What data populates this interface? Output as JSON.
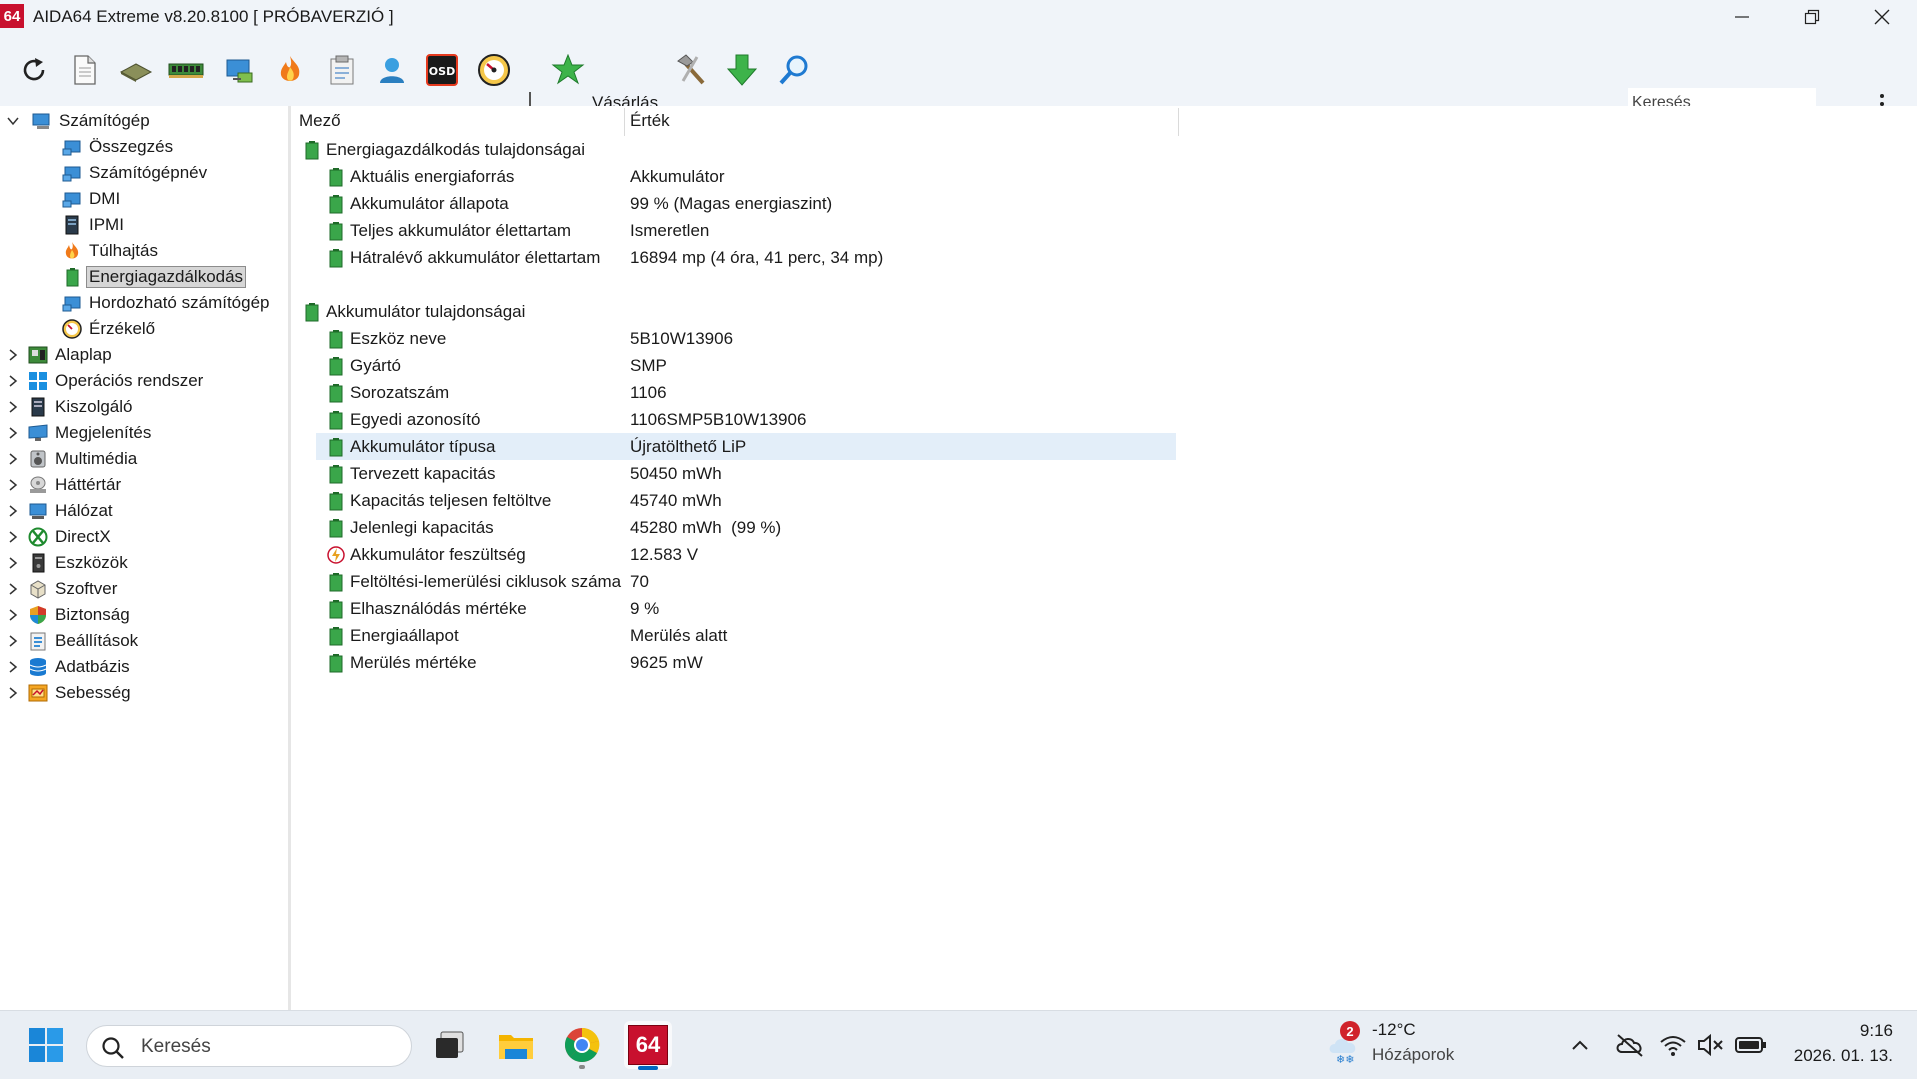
{
  "window": {
    "logo": "64",
    "title": "AIDA64 Extreme v8.20.8100  [ PRÓBAVERZIÓ ]"
  },
  "toolbar": {
    "buy_label": "Vásárlás",
    "search_placeholder": "Keresés",
    "buttons": [
      "refresh-icon",
      "report-icon",
      "motherboard-icon",
      "memory-icon",
      "computer-icon",
      "flame-icon",
      "clipboard-icon",
      "user-icon",
      "osd-icon",
      "speedometer-icon",
      "buy-star-icon",
      "tools-icon",
      "download-arrow-icon",
      "magnifier-icon"
    ],
    "osd_text": "OSD"
  },
  "tree": {
    "root": "Számítógép",
    "children": [
      "Összegzés",
      "Számítógépnév",
      "DMI",
      "IPMI",
      "Túlhajtás",
      "Energiagazdálkodás",
      "Hordozható számítógép",
      "Érzékelő"
    ],
    "selected": "Energiagazdálkodás",
    "categories": [
      "Alaplap",
      "Operációs rendszer",
      "Kiszolgáló",
      "Megjelenítés",
      "Multimédia",
      "Háttértár",
      "Hálózat",
      "DirectX",
      "Eszközök",
      "Szoftver",
      "Biztonság",
      "Beállítások",
      "Adatbázis",
      "Sebesség"
    ]
  },
  "list": {
    "col_field": "Mező",
    "col_value": "Érték",
    "group1": "Energiagazdálkodás tulajdonságai",
    "group1_rows": [
      {
        "field": "Aktuális energiaforrás",
        "value": "Akkumulátor"
      },
      {
        "field": "Akkumulátor állapota",
        "value": "99 % (Magas energiaszint)"
      },
      {
        "field": "Teljes akkumulátor élettartam",
        "value": "Ismeretlen"
      },
      {
        "field": "Hátralévő akkumulátor élettartam",
        "value": "16894 mp (4 óra, 41 perc, 34 mp)"
      }
    ],
    "group2": "Akkumulátor tulajdonságai",
    "group2_rows": [
      {
        "field": "Eszköz neve",
        "value": "5B10W13906"
      },
      {
        "field": "Gyártó",
        "value": "SMP"
      },
      {
        "field": "Sorozatszám",
        "value": "1106"
      },
      {
        "field": "Egyedi azonosító",
        "value": "1106SMP5B10W13906"
      },
      {
        "field": "Akkumulátor típusa",
        "value": "Újratölthető LiP"
      },
      {
        "field": "Tervezett kapacitás",
        "value": "50450 mWh"
      },
      {
        "field": "Kapacitás teljesen feltöltve",
        "value": "45740 mWh"
      },
      {
        "field": "Jelenlegi kapacitás",
        "value": "45280 mWh  (99 %)"
      },
      {
        "field": "Akkumulátor feszültség",
        "value": "12.583 V"
      },
      {
        "field": "Feltöltési-lemerülési ciklusok száma",
        "value": "70"
      },
      {
        "field": "Elhasználódás mértéke",
        "value": "9 %"
      },
      {
        "field": "Energiaállapot",
        "value": "Merülés alatt"
      },
      {
        "field": "Merülés mértéke",
        "value": "9625 mW"
      }
    ],
    "highlighted_field": "Akkumulátor típusa"
  },
  "taskbar": {
    "search_placeholder": "Keresés",
    "weather_badge": "2",
    "weather_temp": "-12°C",
    "weather_desc": "Hózáporok",
    "time": "9:16",
    "date": "2026. 01. 13.",
    "app_badge": "64"
  },
  "colors": {
    "accent": "#0067c0",
    "chrome": "#f0f4f9",
    "selection_bg": "#e3eef9",
    "aida_red": "#c8102e",
    "battery_green": "#3aa64a"
  }
}
